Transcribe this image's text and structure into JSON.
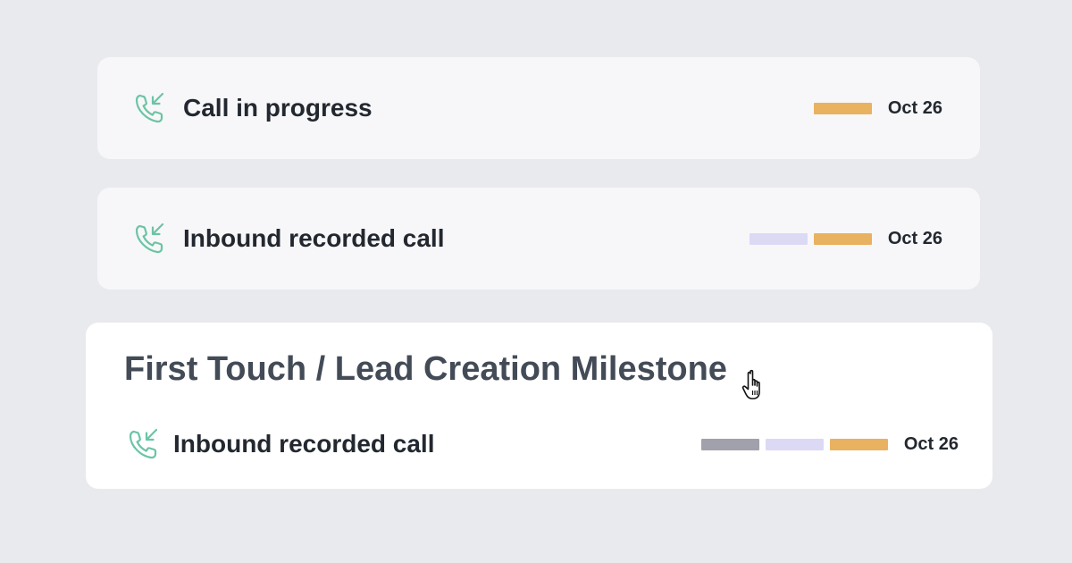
{
  "items": [
    {
      "icon": "inbound-call-icon",
      "label": "Call in progress",
      "date": "Oct 26",
      "bars": [
        "orange"
      ]
    },
    {
      "icon": "inbound-call-icon",
      "label": "Inbound recorded call",
      "date": "Oct 26",
      "bars": [
        "lavender",
        "orange"
      ]
    }
  ],
  "milestone": {
    "title": "First Touch / Lead Creation Milestone",
    "item": {
      "icon": "inbound-call-icon",
      "label": "Inbound recorded call",
      "date": "Oct 26",
      "bars": [
        "gray",
        "lavender",
        "orange"
      ]
    }
  },
  "colors": {
    "background": "#e9eaee",
    "card_compact": "#f7f7f9",
    "card_expanded": "#ffffff",
    "icon_green": "#6cc4a4",
    "bar_orange": "#e8b260",
    "bar_lavender": "#dcd9f5",
    "bar_gray": "#a1a1ab",
    "text_dark": "#232830",
    "text_milestone": "#434b57"
  },
  "cursor": "hand-pointer-icon"
}
